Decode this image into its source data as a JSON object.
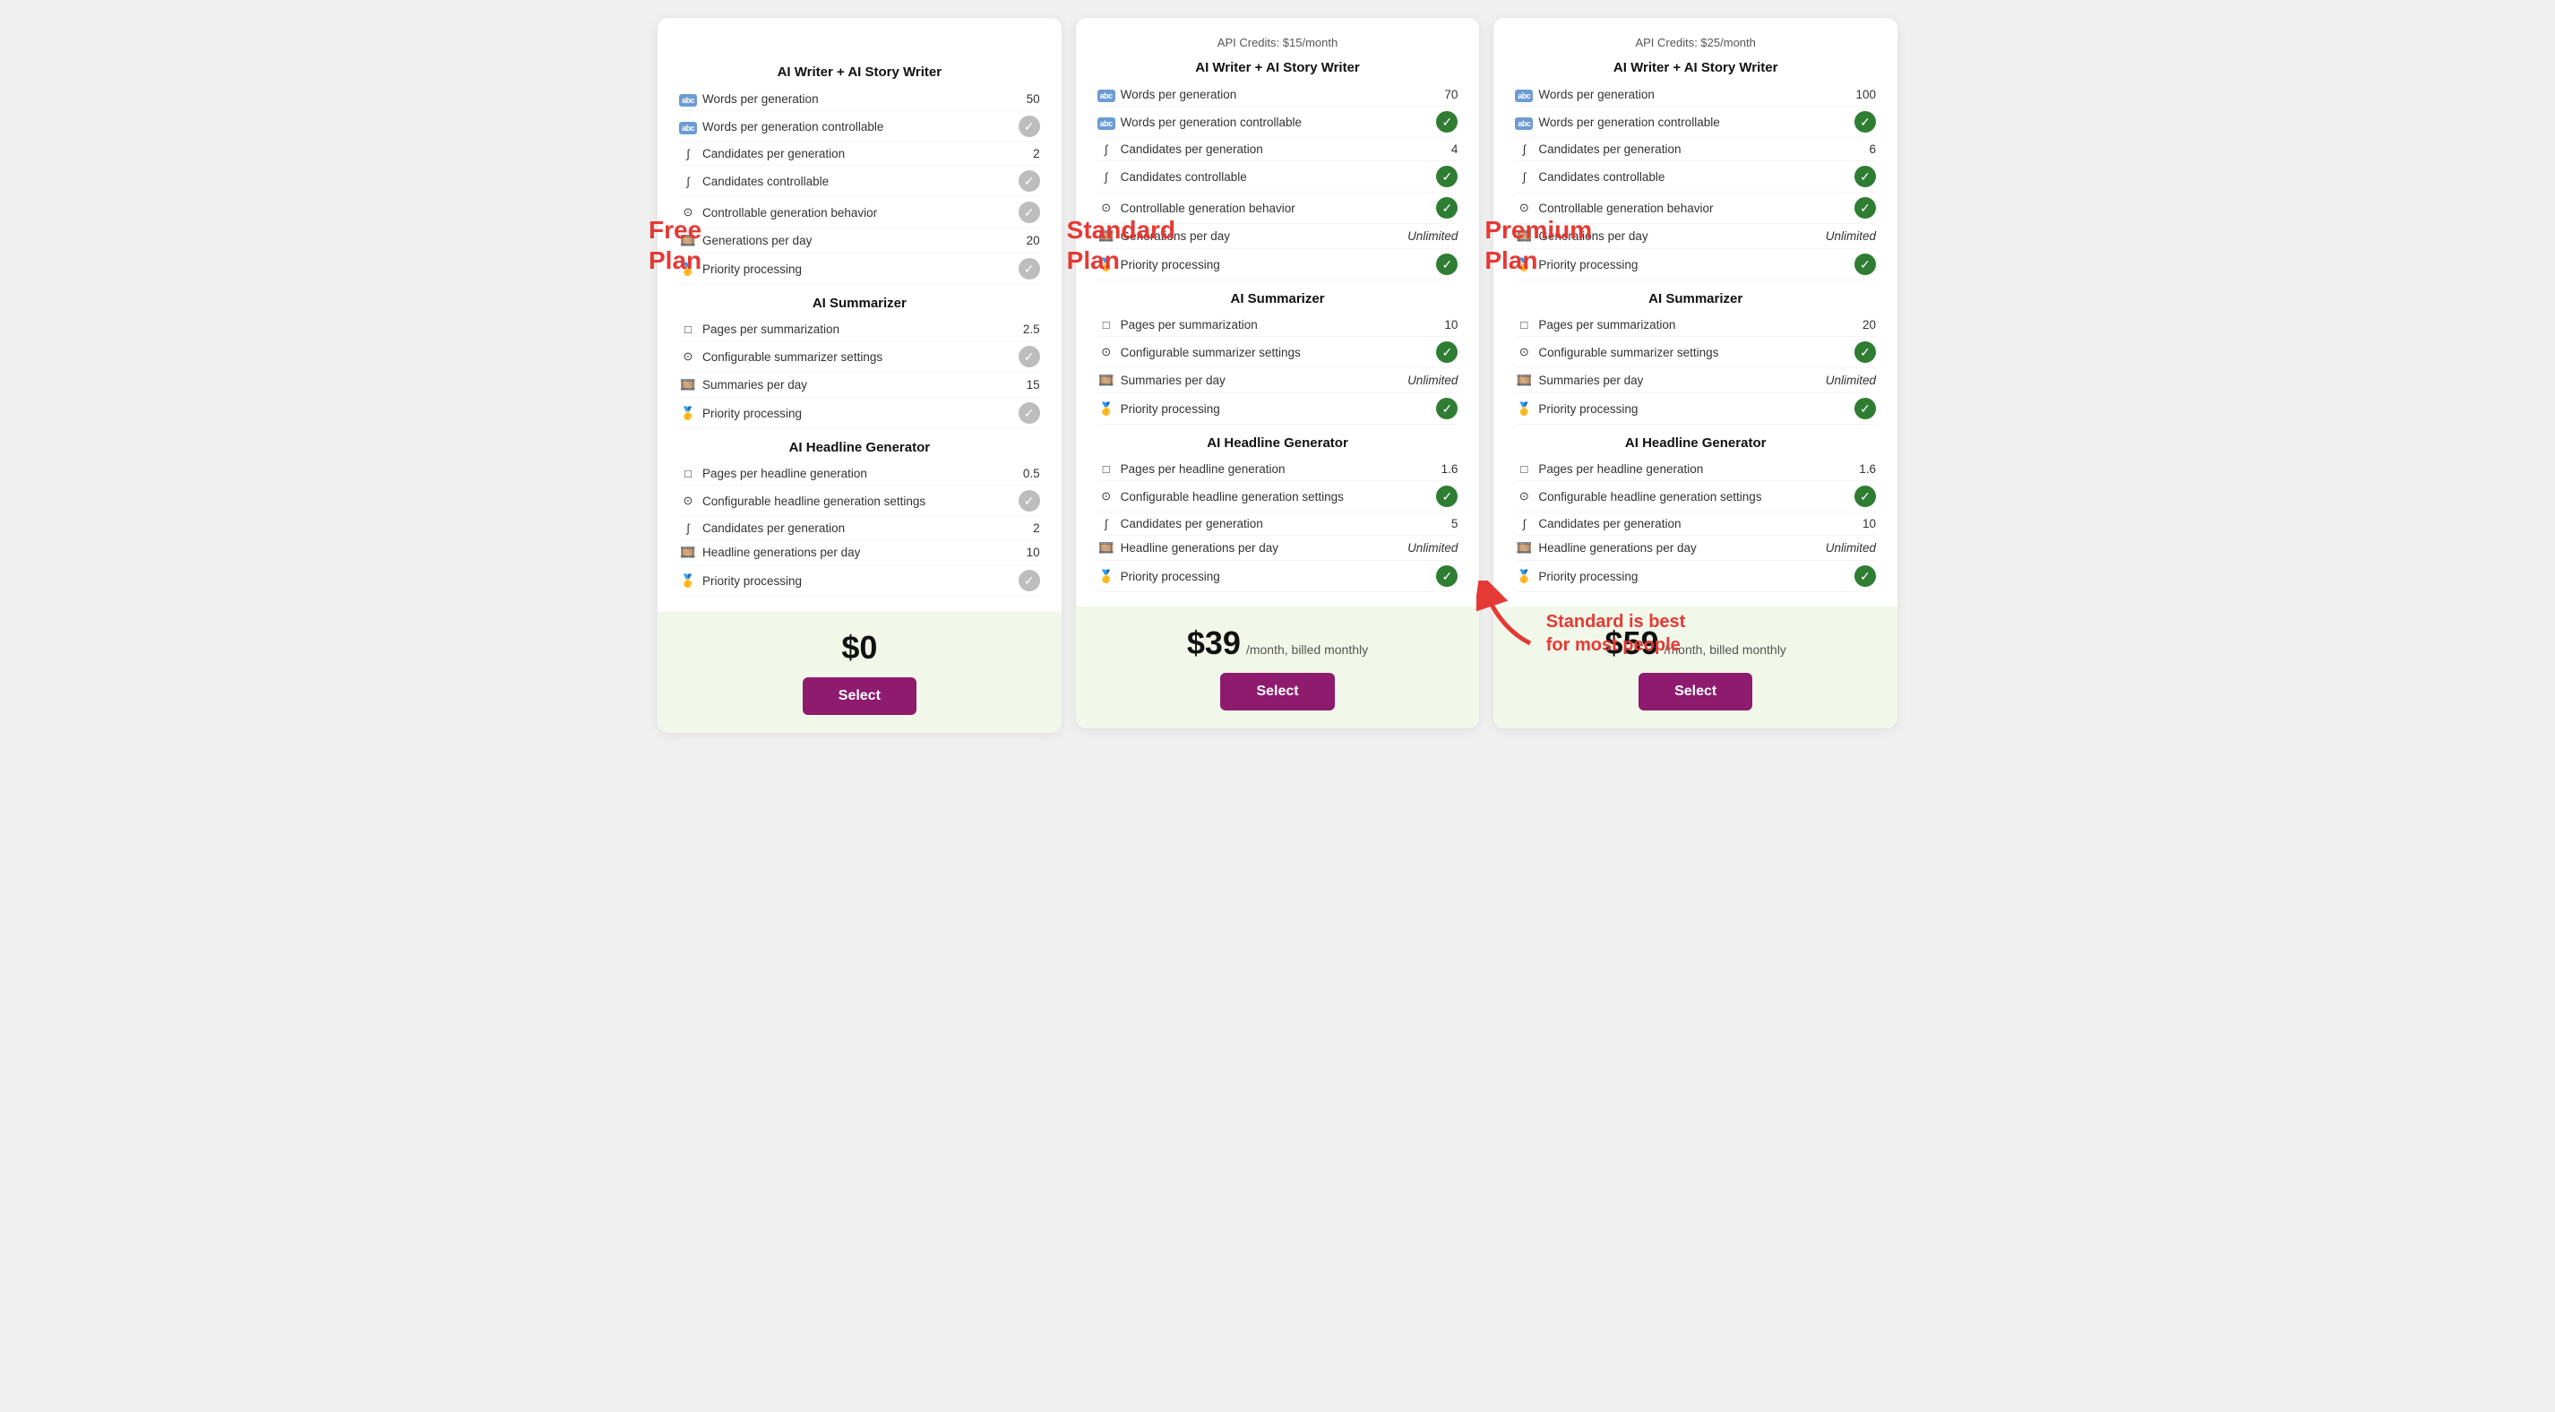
{
  "plans": [
    {
      "id": "free",
      "label": "Free\nPlan",
      "show_api_credits": false,
      "api_credits": "",
      "price": "$0",
      "price_suffix": "",
      "select_label": "Select",
      "sections": [
        {
          "title": "AI Writer + AI Story Writer",
          "features": [
            {
              "icon": "abc",
              "icon_type": "text_icon",
              "name": "Words per generation",
              "value": "50",
              "check": null
            },
            {
              "icon": "abc",
              "icon_type": "text_icon",
              "name": "Words per generation controllable",
              "value": null,
              "check": "gray"
            },
            {
              "icon": "∫",
              "icon_type": "text",
              "name": "Candidates per generation",
              "value": "2",
              "check": null
            },
            {
              "icon": "∫",
              "icon_type": "text",
              "name": "Candidates controllable",
              "value": null,
              "check": "gray"
            },
            {
              "icon": "⊙",
              "icon_type": "text",
              "name": "Controllable generation behavior",
              "value": null,
              "check": "gray"
            },
            {
              "icon": "🎞️",
              "icon_type": "emoji",
              "name": "Generations per day",
              "value": "20",
              "check": null
            },
            {
              "icon": "🥇",
              "icon_type": "emoji",
              "name": "Priority processing",
              "value": null,
              "check": "gray"
            }
          ]
        },
        {
          "title": "AI Summarizer",
          "features": [
            {
              "icon": "□",
              "icon_type": "text",
              "name": "Pages per summarization",
              "value": "2.5",
              "check": null
            },
            {
              "icon": "⊙",
              "icon_type": "text",
              "name": "Configurable summarizer settings",
              "value": null,
              "check": "gray"
            },
            {
              "icon": "🎞️",
              "icon_type": "emoji",
              "name": "Summaries per day",
              "value": "15",
              "check": null
            },
            {
              "icon": "🥇",
              "icon_type": "emoji",
              "name": "Priority processing",
              "value": null,
              "check": "gray"
            }
          ]
        },
        {
          "title": "AI Headline Generator",
          "features": [
            {
              "icon": "□",
              "icon_type": "text",
              "name": "Pages per headline generation",
              "value": "0.5",
              "check": null
            },
            {
              "icon": "⊙",
              "icon_type": "text",
              "name": "Configurable headline generation settings",
              "value": null,
              "check": "gray"
            },
            {
              "icon": "∫",
              "icon_type": "text",
              "name": "Candidates per generation",
              "value": "2",
              "check": null
            },
            {
              "icon": "🎞️",
              "icon_type": "emoji",
              "name": "Headline generations per day",
              "value": "10",
              "check": null
            },
            {
              "icon": "🥇",
              "icon_type": "emoji",
              "name": "Priority processing",
              "value": null,
              "check": "gray"
            }
          ]
        }
      ]
    },
    {
      "id": "standard",
      "label": "Standard\nPlan",
      "show_api_credits": true,
      "api_credits": "API Credits: $15/month",
      "price": "$39",
      "price_suffix": "/month, billed monthly",
      "select_label": "Select",
      "annotation": "Standard is best\nfor most people",
      "sections": [
        {
          "title": "AI Writer + AI Story Writer",
          "features": [
            {
              "icon": "abc",
              "icon_type": "text_icon",
              "name": "Words per generation",
              "value": "70",
              "check": null
            },
            {
              "icon": "abc",
              "icon_type": "text_icon",
              "name": "Words per generation controllable",
              "value": null,
              "check": "green"
            },
            {
              "icon": "∫",
              "icon_type": "text",
              "name": "Candidates per generation",
              "value": "4",
              "check": null
            },
            {
              "icon": "∫",
              "icon_type": "text",
              "name": "Candidates controllable",
              "value": null,
              "check": "green"
            },
            {
              "icon": "⊙",
              "icon_type": "text",
              "name": "Controllable generation behavior",
              "value": null,
              "check": "green"
            },
            {
              "icon": "🎞️",
              "icon_type": "emoji",
              "name": "Generations per day",
              "value": "Unlimited",
              "check": null
            },
            {
              "icon": "🥇",
              "icon_type": "emoji",
              "name": "Priority processing",
              "value": null,
              "check": "green"
            }
          ]
        },
        {
          "title": "AI Summarizer",
          "features": [
            {
              "icon": "□",
              "icon_type": "text",
              "name": "Pages per summarization",
              "value": "10",
              "check": null
            },
            {
              "icon": "⊙",
              "icon_type": "text",
              "name": "Configurable summarizer settings",
              "value": null,
              "check": "green"
            },
            {
              "icon": "🎞️",
              "icon_type": "emoji",
              "name": "Summaries per day",
              "value": "Unlimited",
              "check": null
            },
            {
              "icon": "🥇",
              "icon_type": "emoji",
              "name": "Priority processing",
              "value": null,
              "check": "green"
            }
          ]
        },
        {
          "title": "AI Headline Generator",
          "features": [
            {
              "icon": "□",
              "icon_type": "text",
              "name": "Pages per headline generation",
              "value": "1.6",
              "check": null
            },
            {
              "icon": "⊙",
              "icon_type": "text",
              "name": "Configurable headline generation settings",
              "value": null,
              "check": "green"
            },
            {
              "icon": "∫",
              "icon_type": "text",
              "name": "Candidates per generation",
              "value": "5",
              "check": null
            },
            {
              "icon": "🎞️",
              "icon_type": "emoji",
              "name": "Headline generations per day",
              "value": "Unlimited",
              "check": null
            },
            {
              "icon": "🥇",
              "icon_type": "emoji",
              "name": "Priority processing",
              "value": null,
              "check": "green"
            }
          ]
        }
      ]
    },
    {
      "id": "premium",
      "label": "Premium\nPlan",
      "show_api_credits": true,
      "api_credits": "API Credits: $25/month",
      "price": "$59",
      "price_suffix": "/month, billed monthly",
      "select_label": "Select",
      "sections": [
        {
          "title": "AI Writer + AI Story Writer",
          "features": [
            {
              "icon": "abc",
              "icon_type": "text_icon",
              "name": "Words per generation",
              "value": "100",
              "check": null
            },
            {
              "icon": "abc",
              "icon_type": "text_icon",
              "name": "Words per generation controllable",
              "value": null,
              "check": "green"
            },
            {
              "icon": "∫",
              "icon_type": "text",
              "name": "Candidates per generation",
              "value": "6",
              "check": null
            },
            {
              "icon": "∫",
              "icon_type": "text",
              "name": "Candidates controllable",
              "value": null,
              "check": "green"
            },
            {
              "icon": "⊙",
              "icon_type": "text",
              "name": "Controllable generation behavior",
              "value": null,
              "check": "green"
            },
            {
              "icon": "🎞️",
              "icon_type": "emoji",
              "name": "Generations per day",
              "value": "Unlimited",
              "check": null
            },
            {
              "icon": "🥇",
              "icon_type": "emoji",
              "name": "Priority processing",
              "value": null,
              "check": "green"
            }
          ]
        },
        {
          "title": "AI Summarizer",
          "features": [
            {
              "icon": "□",
              "icon_type": "text",
              "name": "Pages per summarization",
              "value": "20",
              "check": null
            },
            {
              "icon": "⊙",
              "icon_type": "text",
              "name": "Configurable summarizer settings",
              "value": null,
              "check": "green"
            },
            {
              "icon": "🎞️",
              "icon_type": "emoji",
              "name": "Summaries per day",
              "value": "Unlimited",
              "check": null
            },
            {
              "icon": "🥇",
              "icon_type": "emoji",
              "name": "Priority processing",
              "value": null,
              "check": "green"
            }
          ]
        },
        {
          "title": "AI Headline Generator",
          "features": [
            {
              "icon": "□",
              "icon_type": "text",
              "name": "Pages per headline generation",
              "value": "1.6",
              "check": null
            },
            {
              "icon": "⊙",
              "icon_type": "text",
              "name": "Configurable headline generation settings",
              "value": null,
              "check": "green"
            },
            {
              "icon": "∫",
              "icon_type": "text",
              "name": "Candidates per generation",
              "value": "10",
              "check": null
            },
            {
              "icon": "🎞️",
              "icon_type": "emoji",
              "name": "Headline generations per day",
              "value": "Unlimited",
              "check": null
            },
            {
              "icon": "🥇",
              "icon_type": "emoji",
              "name": "Priority processing",
              "value": null,
              "check": "green"
            }
          ]
        }
      ]
    }
  ],
  "annotation": {
    "text": "Standard is best\nfor most people"
  },
  "icons": {
    "checkmark": "✓",
    "abc_icon": "abc",
    "film_icon": "🎞",
    "medal_icon": "🥇",
    "pages_icon": "□",
    "settings_icon": "⊙",
    "candidates_icon": "∫"
  }
}
